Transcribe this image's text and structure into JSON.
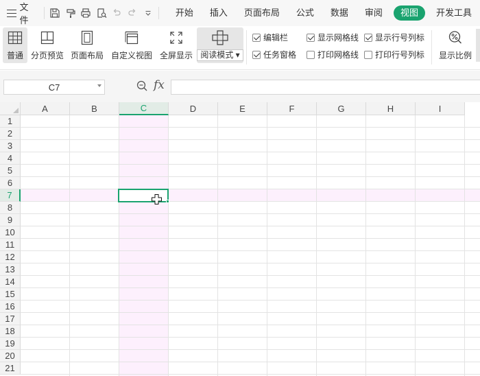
{
  "menubar": {
    "file_label": "文件",
    "quick_access": [
      "save-icon",
      "format-painter-icon",
      "print-icon",
      "print-preview-icon",
      "undo-icon",
      "redo-icon",
      "customize-dropdown-icon"
    ],
    "tabs": [
      "开始",
      "插入",
      "页面布局",
      "公式",
      "数据",
      "审阅",
      "视图",
      "开发工具"
    ],
    "active_tab": "视图"
  },
  "ribbon": {
    "normal": "普通",
    "page_break_preview": "分页预览",
    "page_layout": "页面布局",
    "custom_view": "自定义视图",
    "full_screen": "全屏显示",
    "reading_mode": "阅读模式",
    "options": {
      "formula_bar": {
        "label": "编辑栏",
        "checked": true
      },
      "task_pane": {
        "label": "任务窗格",
        "checked": true
      },
      "show_gridlines": {
        "label": "显示网格线",
        "checked": true
      },
      "print_gridlines": {
        "label": "打印网格线",
        "checked": false
      },
      "show_headers": {
        "label": "显示行号列标",
        "checked": true
      },
      "print_headers": {
        "label": "打印行号列标",
        "checked": false
      }
    },
    "zoom": "显示比例"
  },
  "formula_bar": {
    "cell_ref": "C7",
    "fx": "fx",
    "content": ""
  },
  "sheet": {
    "columns": [
      "A",
      "B",
      "C",
      "D",
      "E",
      "F",
      "G",
      "H",
      "I"
    ],
    "rows": [
      "1",
      "2",
      "3",
      "4",
      "5",
      "6",
      "7",
      "8",
      "9",
      "10",
      "11",
      "12",
      "13",
      "14",
      "15",
      "16",
      "17",
      "18",
      "19",
      "20",
      "21"
    ],
    "active_column": "C",
    "active_row": "7"
  },
  "colors": {
    "accent": "#1aa36f",
    "highlight": "#fdf0fd"
  }
}
